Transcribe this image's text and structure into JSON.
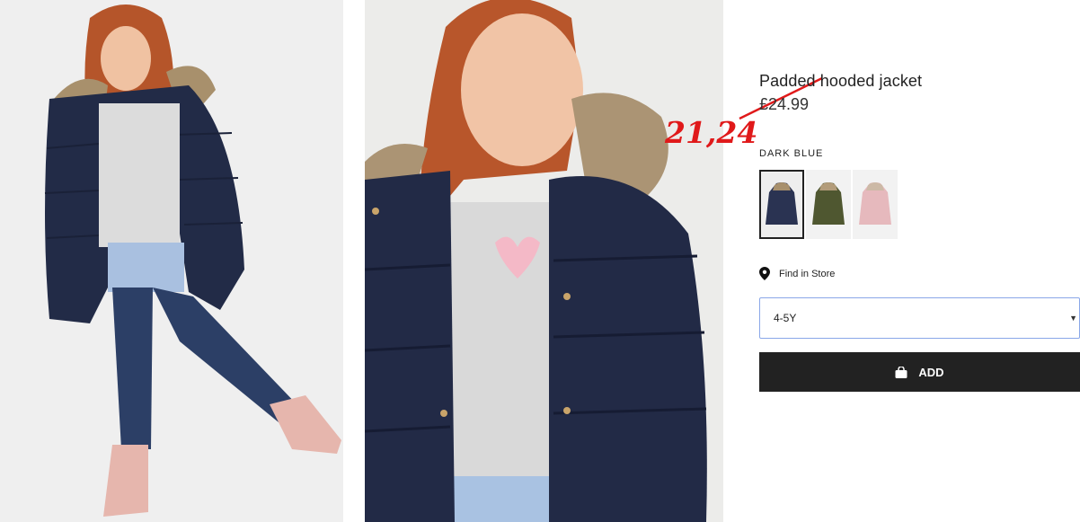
{
  "product": {
    "title": "Padded hooded jacket",
    "old_price": "£24.99",
    "color_label": "DARK BLUE",
    "swatches": [
      {
        "name": "dark-blue",
        "color": "#2a3352"
      },
      {
        "name": "khaki",
        "color": "#4f5730"
      },
      {
        "name": "pink",
        "color": "#e6b9bd"
      }
    ],
    "find_in_store": "Find in Store",
    "size_selected": "4-5Y",
    "add_label": "ADD"
  },
  "annotation": {
    "handwritten_price": "21,24",
    "color": "#e0191a"
  },
  "icons": {
    "location": "location-pin-icon",
    "bag": "shopping-bag-icon",
    "dropdown": "chevron-down-icon"
  }
}
